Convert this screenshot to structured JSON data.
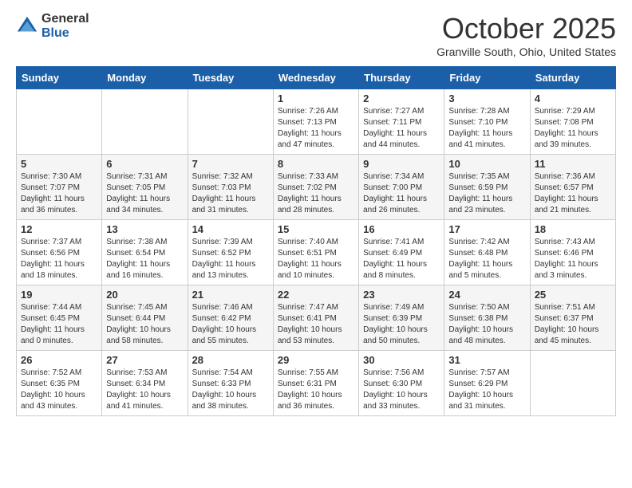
{
  "header": {
    "logo_general": "General",
    "logo_blue": "Blue",
    "month_title": "October 2025",
    "location": "Granville South, Ohio, United States"
  },
  "days_of_week": [
    "Sunday",
    "Monday",
    "Tuesday",
    "Wednesday",
    "Thursday",
    "Friday",
    "Saturday"
  ],
  "weeks": [
    [
      {
        "day": "",
        "info": ""
      },
      {
        "day": "",
        "info": ""
      },
      {
        "day": "",
        "info": ""
      },
      {
        "day": "1",
        "info": "Sunrise: 7:26 AM\nSunset: 7:13 PM\nDaylight: 11 hours and 47 minutes."
      },
      {
        "day": "2",
        "info": "Sunrise: 7:27 AM\nSunset: 7:11 PM\nDaylight: 11 hours and 44 minutes."
      },
      {
        "day": "3",
        "info": "Sunrise: 7:28 AM\nSunset: 7:10 PM\nDaylight: 11 hours and 41 minutes."
      },
      {
        "day": "4",
        "info": "Sunrise: 7:29 AM\nSunset: 7:08 PM\nDaylight: 11 hours and 39 minutes."
      }
    ],
    [
      {
        "day": "5",
        "info": "Sunrise: 7:30 AM\nSunset: 7:07 PM\nDaylight: 11 hours and 36 minutes."
      },
      {
        "day": "6",
        "info": "Sunrise: 7:31 AM\nSunset: 7:05 PM\nDaylight: 11 hours and 34 minutes."
      },
      {
        "day": "7",
        "info": "Sunrise: 7:32 AM\nSunset: 7:03 PM\nDaylight: 11 hours and 31 minutes."
      },
      {
        "day": "8",
        "info": "Sunrise: 7:33 AM\nSunset: 7:02 PM\nDaylight: 11 hours and 28 minutes."
      },
      {
        "day": "9",
        "info": "Sunrise: 7:34 AM\nSunset: 7:00 PM\nDaylight: 11 hours and 26 minutes."
      },
      {
        "day": "10",
        "info": "Sunrise: 7:35 AM\nSunset: 6:59 PM\nDaylight: 11 hours and 23 minutes."
      },
      {
        "day": "11",
        "info": "Sunrise: 7:36 AM\nSunset: 6:57 PM\nDaylight: 11 hours and 21 minutes."
      }
    ],
    [
      {
        "day": "12",
        "info": "Sunrise: 7:37 AM\nSunset: 6:56 PM\nDaylight: 11 hours and 18 minutes."
      },
      {
        "day": "13",
        "info": "Sunrise: 7:38 AM\nSunset: 6:54 PM\nDaylight: 11 hours and 16 minutes."
      },
      {
        "day": "14",
        "info": "Sunrise: 7:39 AM\nSunset: 6:52 PM\nDaylight: 11 hours and 13 minutes."
      },
      {
        "day": "15",
        "info": "Sunrise: 7:40 AM\nSunset: 6:51 PM\nDaylight: 11 hours and 10 minutes."
      },
      {
        "day": "16",
        "info": "Sunrise: 7:41 AM\nSunset: 6:49 PM\nDaylight: 11 hours and 8 minutes."
      },
      {
        "day": "17",
        "info": "Sunrise: 7:42 AM\nSunset: 6:48 PM\nDaylight: 11 hours and 5 minutes."
      },
      {
        "day": "18",
        "info": "Sunrise: 7:43 AM\nSunset: 6:46 PM\nDaylight: 11 hours and 3 minutes."
      }
    ],
    [
      {
        "day": "19",
        "info": "Sunrise: 7:44 AM\nSunset: 6:45 PM\nDaylight: 11 hours and 0 minutes."
      },
      {
        "day": "20",
        "info": "Sunrise: 7:45 AM\nSunset: 6:44 PM\nDaylight: 10 hours and 58 minutes."
      },
      {
        "day": "21",
        "info": "Sunrise: 7:46 AM\nSunset: 6:42 PM\nDaylight: 10 hours and 55 minutes."
      },
      {
        "day": "22",
        "info": "Sunrise: 7:47 AM\nSunset: 6:41 PM\nDaylight: 10 hours and 53 minutes."
      },
      {
        "day": "23",
        "info": "Sunrise: 7:49 AM\nSunset: 6:39 PM\nDaylight: 10 hours and 50 minutes."
      },
      {
        "day": "24",
        "info": "Sunrise: 7:50 AM\nSunset: 6:38 PM\nDaylight: 10 hours and 48 minutes."
      },
      {
        "day": "25",
        "info": "Sunrise: 7:51 AM\nSunset: 6:37 PM\nDaylight: 10 hours and 45 minutes."
      }
    ],
    [
      {
        "day": "26",
        "info": "Sunrise: 7:52 AM\nSunset: 6:35 PM\nDaylight: 10 hours and 43 minutes."
      },
      {
        "day": "27",
        "info": "Sunrise: 7:53 AM\nSunset: 6:34 PM\nDaylight: 10 hours and 41 minutes."
      },
      {
        "day": "28",
        "info": "Sunrise: 7:54 AM\nSunset: 6:33 PM\nDaylight: 10 hours and 38 minutes."
      },
      {
        "day": "29",
        "info": "Sunrise: 7:55 AM\nSunset: 6:31 PM\nDaylight: 10 hours and 36 minutes."
      },
      {
        "day": "30",
        "info": "Sunrise: 7:56 AM\nSunset: 6:30 PM\nDaylight: 10 hours and 33 minutes."
      },
      {
        "day": "31",
        "info": "Sunrise: 7:57 AM\nSunset: 6:29 PM\nDaylight: 10 hours and 31 minutes."
      },
      {
        "day": "",
        "info": ""
      }
    ]
  ]
}
